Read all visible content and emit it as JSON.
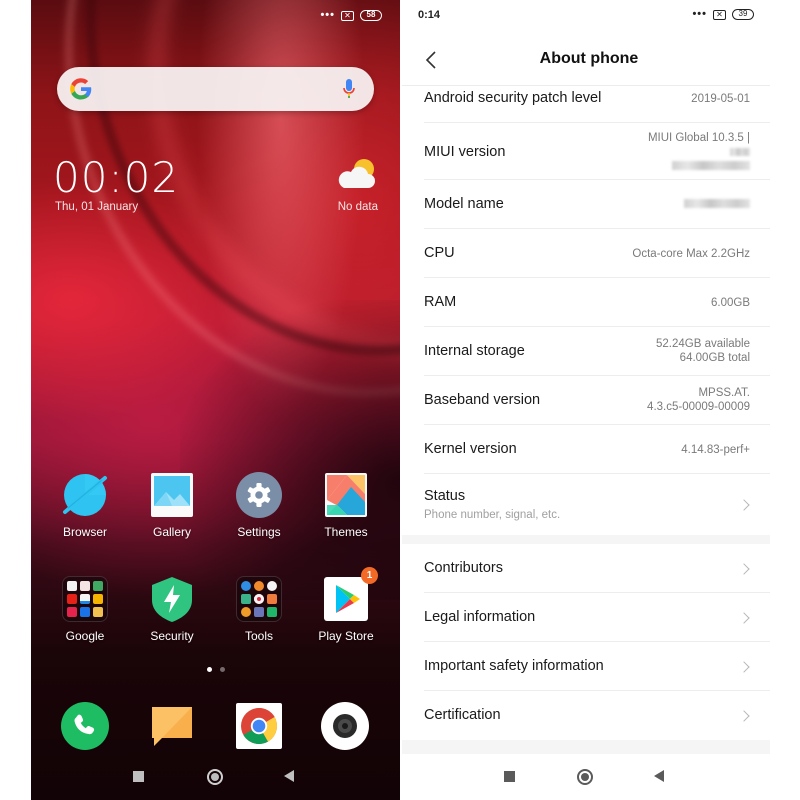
{
  "home_screen": {
    "status_bar": {
      "more_indicator": "•••",
      "sim_status": "✕",
      "battery_level": "58"
    },
    "search_bar": {
      "logo": "google-g-logo",
      "mic_icon": "mic-icon"
    },
    "clock_widget": {
      "time": "00:02",
      "date": "Thu, 01 January"
    },
    "weather_widget": {
      "icon": "partly-cloudy-icon",
      "text": "No data"
    },
    "apps_row1": [
      {
        "label": "Browser",
        "icon": "browser-icon"
      },
      {
        "label": "Gallery",
        "icon": "gallery-icon"
      },
      {
        "label": "Settings",
        "icon": "settings-gear-icon"
      },
      {
        "label": "Themes",
        "icon": "themes-icon"
      }
    ],
    "apps_row2": [
      {
        "label": "Google",
        "icon": "google-folder-icon"
      },
      {
        "label": "Security",
        "icon": "security-shield-icon"
      },
      {
        "label": "Tools",
        "icon": "tools-folder-icon"
      },
      {
        "label": "Play Store",
        "icon": "play-store-icon",
        "badge": "1"
      }
    ],
    "pager": {
      "pages": 2,
      "current": 1
    },
    "dock": [
      {
        "name": "Phone",
        "icon": "phone-icon"
      },
      {
        "name": "Messages",
        "icon": "messages-icon"
      },
      {
        "name": "Chrome",
        "icon": "chrome-icon"
      },
      {
        "name": "Camera",
        "icon": "camera-icon"
      }
    ],
    "nav_bar": [
      "recents",
      "home",
      "back"
    ],
    "colors": {
      "badge": "#f26a25",
      "security": "#2fc47f",
      "phone": "#1fbd63"
    }
  },
  "about_phone": {
    "status_bar": {
      "time": "0:14",
      "more_indicator": "•••",
      "sim_status": "✕",
      "battery_level": "39"
    },
    "title": "About phone",
    "items": [
      {
        "label": "Android security patch level",
        "value": "2019-05-01"
      },
      {
        "label": "MIUI version",
        "value": "MIUI Global 10.3.5 |",
        "value_redacted": true
      },
      {
        "label": "Model name",
        "value_redacted": true
      },
      {
        "label": "CPU",
        "value": "Octa-core Max 2.2GHz"
      },
      {
        "label": "RAM",
        "value": "6.00GB"
      },
      {
        "label": "Internal storage",
        "value": "52.24GB available",
        "value2": "64.00GB total"
      },
      {
        "label": "Baseband version",
        "value": "MPSS.AT.",
        "value2": "4.3.c5-00009-00009"
      },
      {
        "label": "Kernel version",
        "value": "4.14.83-perf+"
      },
      {
        "label": "Status",
        "sublabel": "Phone number, signal, etc.",
        "has_chevron": true
      }
    ],
    "links": [
      {
        "label": "Contributors"
      },
      {
        "label": "Legal information"
      },
      {
        "label": "Important safety information"
      },
      {
        "label": "Certification"
      }
    ],
    "nav_bar": [
      "recents",
      "home",
      "back"
    ]
  }
}
